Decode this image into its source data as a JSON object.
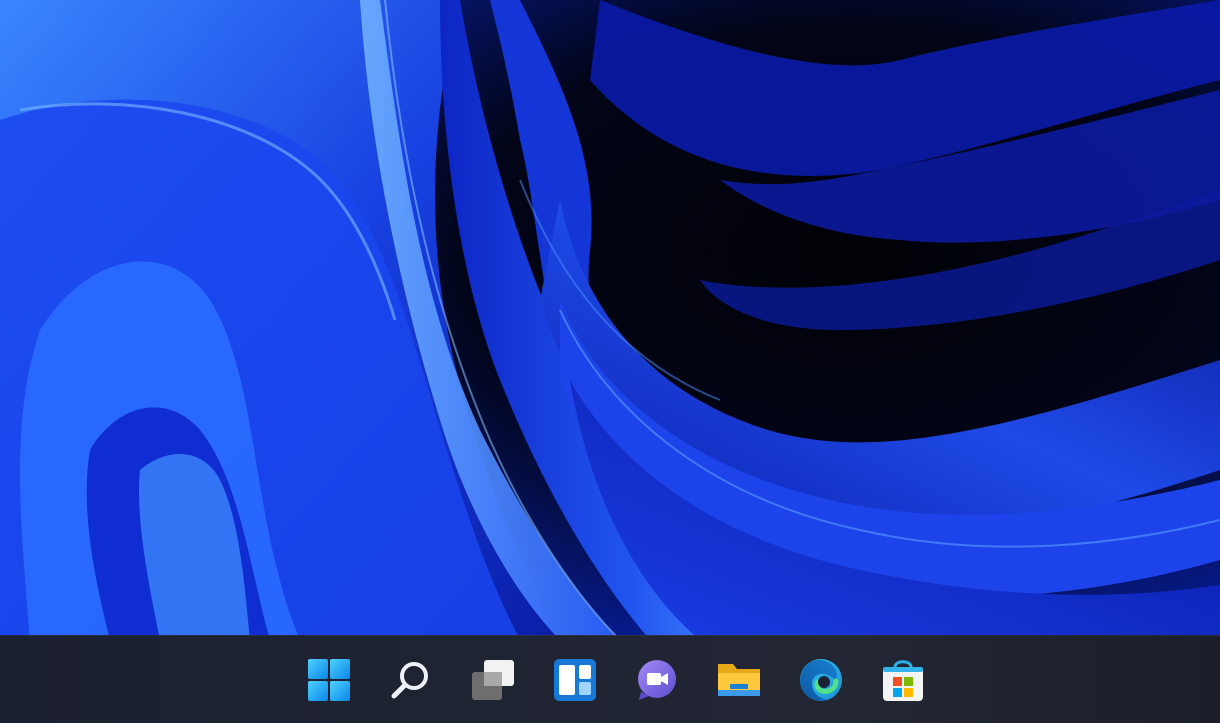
{
  "desktop": {
    "wallpaper": "windows-11-bloom",
    "colors": {
      "wallpaper_base": "#02040f",
      "bloom_bright": "#2a6bff",
      "bloom_mid": "#1532d8",
      "bloom_dark": "#06106a",
      "taskbar": "#1f2433"
    }
  },
  "taskbar": {
    "items": [
      {
        "name": "start",
        "icon": "windows-logo-icon"
      },
      {
        "name": "search",
        "icon": "search-icon"
      },
      {
        "name": "task-view",
        "icon": "task-view-icon"
      },
      {
        "name": "widgets",
        "icon": "widgets-icon"
      },
      {
        "name": "chat",
        "icon": "teams-chat-icon"
      },
      {
        "name": "file-explorer",
        "icon": "folder-icon"
      },
      {
        "name": "edge",
        "icon": "edge-browser-icon"
      },
      {
        "name": "store",
        "icon": "microsoft-store-icon"
      }
    ]
  }
}
